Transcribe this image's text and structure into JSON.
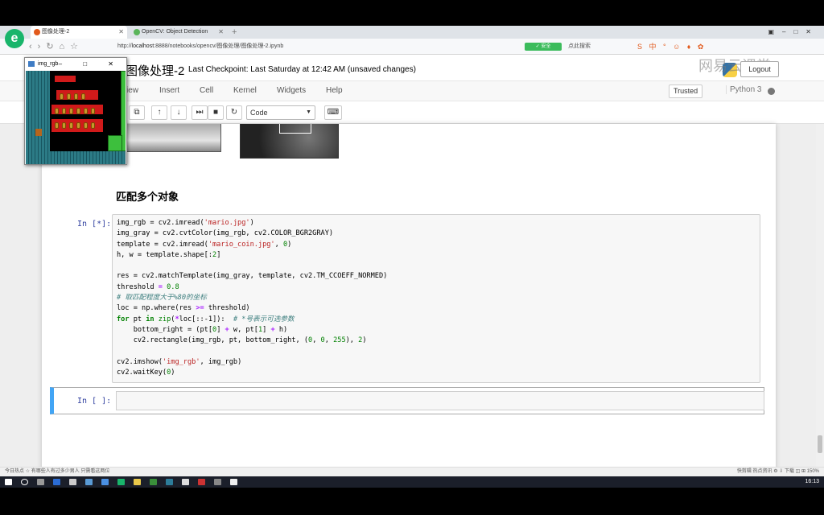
{
  "browser": {
    "tabs": [
      {
        "title": "图像处理-2",
        "active": true,
        "icon_color": "#e25a1c"
      },
      {
        "title": "OpenCV: Object Detection",
        "active": false,
        "icon_color": "#5ab55a"
      }
    ],
    "new_tab": "+",
    "url_prefix": "http://",
    "url_host": "localhost",
    "url_rest": ":8888/notebooks/opencv/图像处理/图像处理-2.ipynb",
    "badge": "✓ 安全",
    "search_label": "点此搜索",
    "sogou": "S 中 ° ☺ ♦ ✿"
  },
  "jupyter": {
    "title": "图像处理-2",
    "checkpoint": "Last Checkpoint: Last Saturday at 12:42 AM (unsaved changes)",
    "logout": "Logout",
    "watermark": "网易云课堂",
    "menu": [
      "iew",
      "Insert",
      "Cell",
      "Kernel",
      "Widgets",
      "Help"
    ],
    "trusted": "Trusted",
    "kernel": "Python 3",
    "cell_type": "Code",
    "markdown_heading": "匹配多个对象",
    "code_prompt": "In [*]:",
    "empty_prompt": "In [ ]:"
  },
  "code_lines": [
    [
      [
        "",
        "img_rgb = cv2.imread("
      ],
      [
        "s",
        "'mario.jpg'"
      ],
      [
        "",
        ")"
      ]
    ],
    [
      [
        "",
        "img_gray = cv2.cvtColor(img_rgb, cv2.COLOR_BGR2GRAY)"
      ]
    ],
    [
      [
        "",
        "template = cv2.imread("
      ],
      [
        "s",
        "'mario_coin.jpg'"
      ],
      [
        "",
        ", "
      ],
      [
        "n",
        "0"
      ],
      [
        "",
        ")"
      ]
    ],
    [
      [
        "",
        "h, w = template.shape[:"
      ],
      [
        "n",
        "2"
      ],
      [
        "",
        "]"
      ]
    ],
    [
      [
        "",
        ""
      ]
    ],
    [
      [
        "",
        "res = cv2.matchTemplate(img_gray, template, cv2.TM_CCOEFF_NORMED)"
      ]
    ],
    [
      [
        "",
        "threshold "
      ],
      [
        "o",
        "="
      ],
      [
        "",
        ""
      ],
      [
        "n",
        " 0.8"
      ]
    ],
    [
      [
        "c",
        "# 取匹配程度大于%80的坐标"
      ]
    ],
    [
      [
        "",
        "loc = np.where(res "
      ],
      [
        "o",
        ">="
      ],
      [
        "",
        ""
      ],
      [
        "",
        ""
      ],
      [
        "",
        " threshold)"
      ]
    ],
    [
      [
        "k",
        "for"
      ],
      [
        "",
        " pt "
      ],
      [
        "k",
        "in"
      ],
      [
        "n",
        " zip"
      ],
      [
        "",
        "("
      ],
      [
        "o",
        "*"
      ],
      [
        "",
        "loc[::-1]):  "
      ],
      [
        "c",
        "# *号表示可选参数"
      ]
    ],
    [
      [
        "",
        "    bottom_right = (pt["
      ],
      [
        "n",
        "0"
      ],
      [
        "",
        "] "
      ],
      [
        "o",
        "+"
      ],
      [
        "",
        " w, pt["
      ],
      [
        "n",
        "1"
      ],
      [
        "",
        "] "
      ],
      [
        "o",
        "+"
      ],
      [
        "",
        " h)"
      ]
    ],
    [
      [
        "",
        "    cv2.rectangle(img_rgb, pt, bottom_right, ("
      ],
      [
        "n",
        "0"
      ],
      [
        "",
        ", "
      ],
      [
        "n",
        "0"
      ],
      [
        "",
        ", "
      ],
      [
        "n",
        "255"
      ],
      [
        "",
        "), "
      ],
      [
        "n",
        "2"
      ],
      [
        "",
        ")"
      ]
    ],
    [
      [
        "",
        ""
      ]
    ],
    [
      [
        "",
        "cv2.imshow("
      ],
      [
        "s",
        "'img_rgb'"
      ],
      [
        "",
        ", img_rgb)"
      ]
    ],
    [
      [
        "",
        "cv2.waitKey("
      ],
      [
        "n",
        "0"
      ],
      [
        "",
        ")"
      ]
    ]
  ],
  "popup": {
    "title": "img_rgb",
    "controls": "–  □  ✕"
  },
  "status": {
    "left": "今日热点    ☆ 有哪些人有过多少男人 只需看这两位",
    "right": "快剪辑   热点资讯   ⚙   ⇩ 下载   ◫   ⊞   150%"
  },
  "clock": "16:13"
}
